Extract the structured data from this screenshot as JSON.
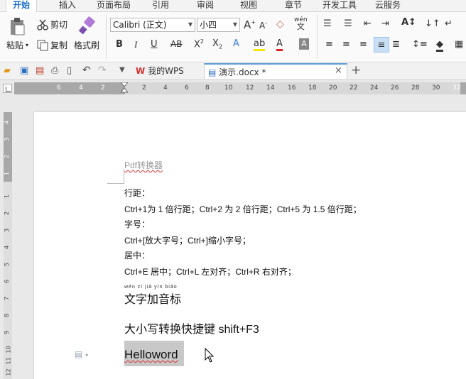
{
  "menu": {
    "tabs": [
      "开始",
      "插入",
      "页面布局",
      "引用",
      "审阅",
      "视图",
      "章节",
      "开发工具",
      "云服务"
    ],
    "active": 0
  },
  "ribbon": {
    "paste_label": "粘贴",
    "cut_label": "剪切",
    "copy_label": "复制",
    "format_painter_label": "格式刷",
    "font_name": "Calibri (正文)",
    "font_size": "小四"
  },
  "quickbar": {
    "wps_tab": "我的WPS",
    "doc_tab": "演示.docx *"
  },
  "ruler": {
    "numbers": [
      "6",
      "4",
      "2",
      "2",
      "4",
      "6",
      "8",
      "10",
      "12",
      "14",
      "16",
      "18",
      "20",
      "22",
      "24",
      "26",
      "28",
      "30",
      "32"
    ],
    "vertical_numbers": [
      "4",
      "3",
      "2",
      "1",
      "1",
      "2",
      "3",
      "4",
      "5",
      "6",
      "7",
      "8",
      "9",
      "10",
      "11",
      "12"
    ]
  },
  "document": {
    "header_text": "Pdf转换器",
    "lines": [
      "行距：",
      "Ctrl+1为 1 倍行距；Ctrl+2 为 2 倍行距；Ctrl+5 为 1.5 倍行距；",
      "字号：",
      "Ctrl+[放大字号；Ctrl+]缩小字号；",
      "居中：",
      "Ctrl+E 居中；Ctrl+L 左对齐；Ctrl+R 右对齐；"
    ],
    "pinyin": "wén  zì  jiā yīn biāo",
    "pinyin_line": "文字加音标",
    "shortcut_line": "大小写转换快捷键 shift+F3",
    "selected_word": "Helloword"
  },
  "colors": {
    "accent": "#1a6fc7",
    "wps_red": "#d9302c",
    "selection": "#c8c8c8"
  }
}
